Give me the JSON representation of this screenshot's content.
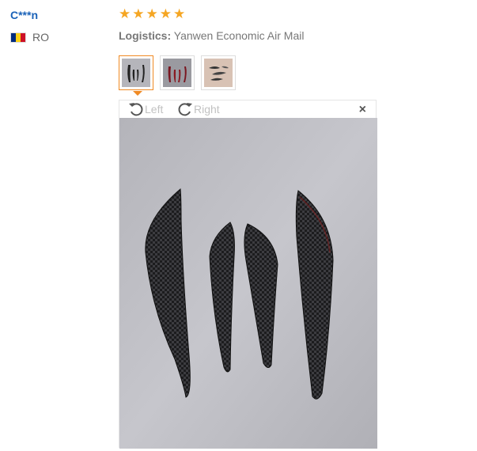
{
  "review": {
    "user_name": "C***n",
    "country_code": "RO",
    "flag_colors": [
      "#002b7f",
      "#fcd116",
      "#ce1126"
    ],
    "rating": 5,
    "star_glyph": "★",
    "logistics_label": "Logistics:",
    "logistics_value": "Yanwen Economic Air Mail"
  },
  "thumbnails": [
    {
      "name": "photo-thumb-1",
      "active": true
    },
    {
      "name": "photo-thumb-2",
      "active": false
    },
    {
      "name": "photo-thumb-3",
      "active": false
    }
  ],
  "viewer": {
    "rotate_left_label": "Left",
    "rotate_right_label": "Right",
    "close_glyph": "×",
    "accent_color": "#f08a24"
  }
}
